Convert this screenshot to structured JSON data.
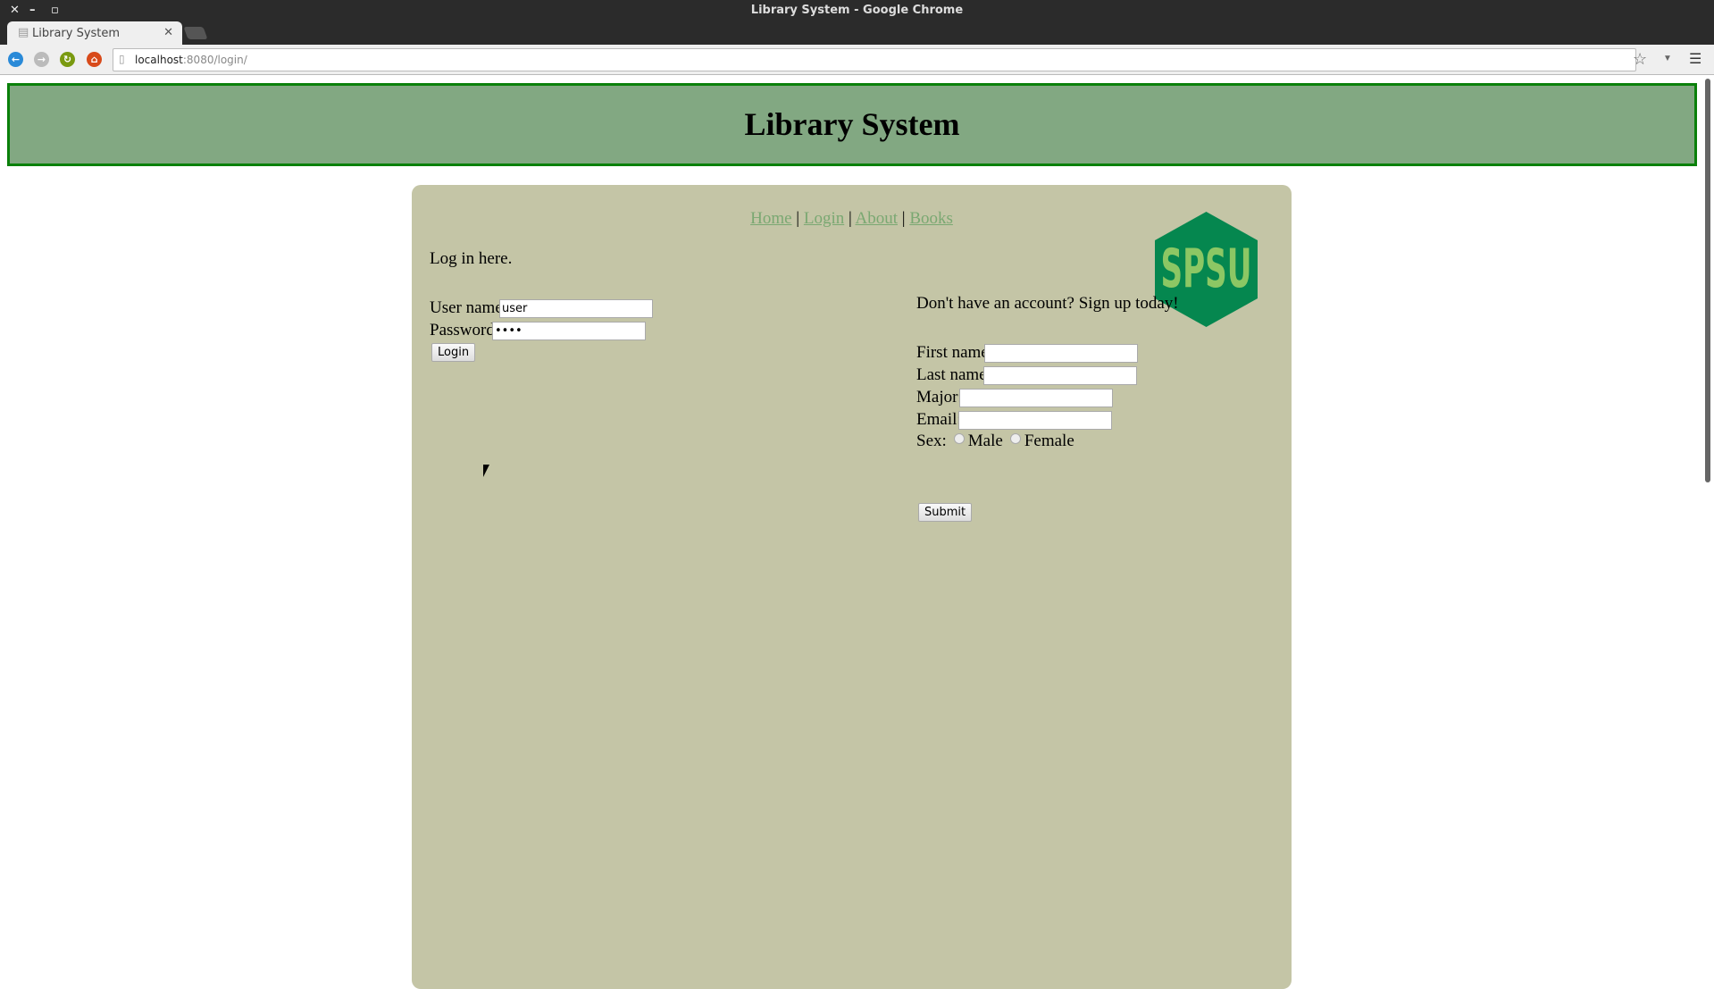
{
  "window": {
    "title": "Library System - Google Chrome"
  },
  "tab": {
    "label": "Library System"
  },
  "address": {
    "host": "localhost",
    "rest": ":8080/login/"
  },
  "header": {
    "title": "Library System"
  },
  "nav": {
    "items": [
      "Home",
      "Login",
      "About",
      "Books"
    ],
    "sep": "|"
  },
  "login": {
    "intro": "Log in here.",
    "username_label": "User name:",
    "username_value": "user",
    "password_label": "Password:",
    "password_value": "pass",
    "button": "Login"
  },
  "signup": {
    "intro": "Don't have an account? Sign up today!",
    "first_label": "First name:",
    "last_label": "Last name:",
    "major_label": "Major:",
    "email_label": "Email:",
    "sex_label": "Sex:",
    "male": "Male",
    "female": "Female",
    "submit": "Submit"
  },
  "logo": {
    "text": "SPSU",
    "color": "#05874f",
    "text_color": "#8cc764"
  }
}
